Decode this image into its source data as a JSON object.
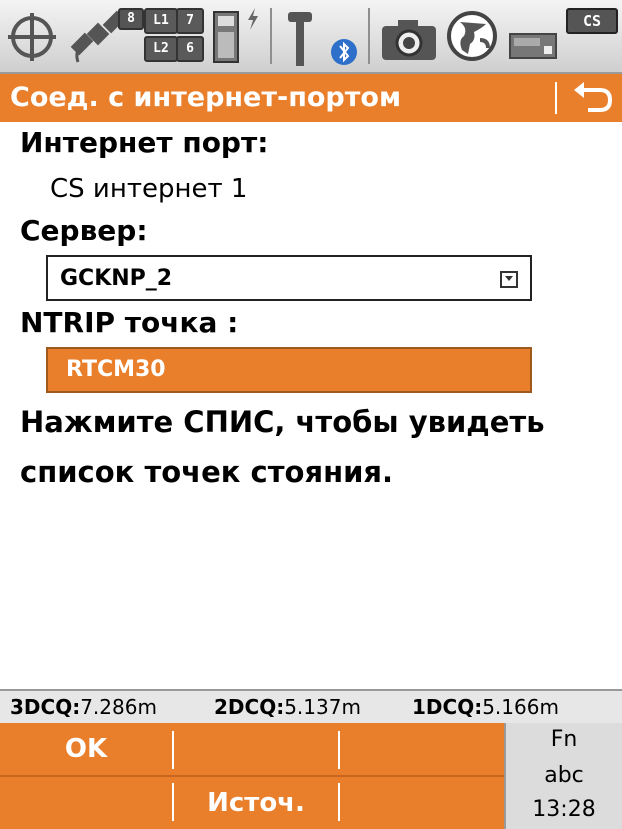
{
  "status_bar": {
    "icons": [
      "crosshair-icon",
      "satellite-icon",
      "l1l2-icon",
      "sd-card-icon",
      "lightning-icon",
      "gnss-antenna-icon",
      "bluetooth-icon",
      "camera-icon",
      "globe-icon",
      "device-icon"
    ],
    "satellites": "8",
    "l1_label": "L1",
    "l1_count": "7",
    "l2_label": "L2",
    "l2_count": "6",
    "cs_badge": "CS"
  },
  "title_bar": {
    "title": "Соед. с интернет-портом",
    "back_icon": "back-arrow-icon"
  },
  "form": {
    "port_label": "Интернет порт:",
    "port_value": "CS интернет 1",
    "server_label": "Сервер:",
    "server_value": "GCKNP_2",
    "ntrip_label": "NTRIP точка :",
    "ntrip_value": "RTCM30",
    "hint_line1": "Нажмите СПИС, чтобы увидеть",
    "hint_line2": "список точек стояния."
  },
  "quality": {
    "q3_label": "3DCQ:",
    "q3_value": "7.286m",
    "q2_label": "2DCQ:",
    "q2_value": "5.137m",
    "q1_label": "1DCQ:",
    "q1_value": "5.166m"
  },
  "softkeys": {
    "ok": "OK",
    "source": "Источ."
  },
  "fn_panel": {
    "fn": "Fn",
    "mode": "abc",
    "time": "13:28"
  },
  "colors": {
    "accent": "#e97e2b",
    "statusbar": "#d9d9d9",
    "fn_panel": "#dcdcdc"
  }
}
